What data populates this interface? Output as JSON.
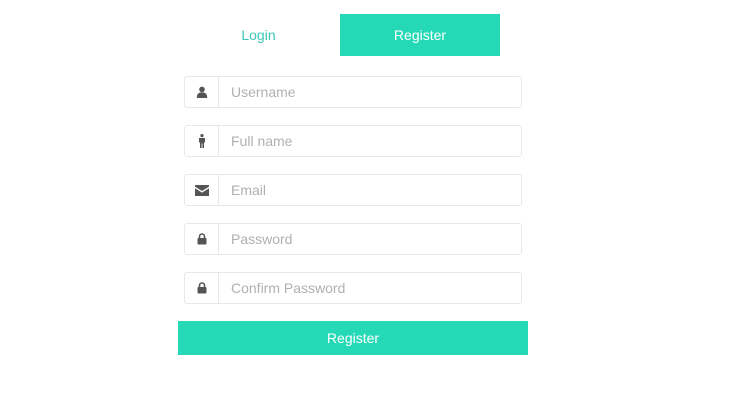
{
  "tabs": {
    "login_label": "Login",
    "register_label": "Register",
    "active": "register"
  },
  "form": {
    "fields": [
      {
        "name": "username",
        "icon": "user-icon",
        "placeholder": "Username",
        "value": ""
      },
      {
        "name": "full_name",
        "icon": "person-icon",
        "placeholder": "Full name",
        "value": ""
      },
      {
        "name": "email",
        "icon": "envelope-icon",
        "placeholder": "Email",
        "value": ""
      },
      {
        "name": "password",
        "icon": "lock-icon",
        "placeholder": "Password",
        "value": ""
      },
      {
        "name": "confirm_password",
        "icon": "lock-icon",
        "placeholder": "Confirm Password",
        "value": ""
      }
    ],
    "submit_label": "Register"
  },
  "colors": {
    "accent": "#26d9b6",
    "tab_inactive_text": "#3cc8b8",
    "icon": "#555555",
    "border": "#e8e8e8",
    "placeholder": "#b0b0b0"
  }
}
